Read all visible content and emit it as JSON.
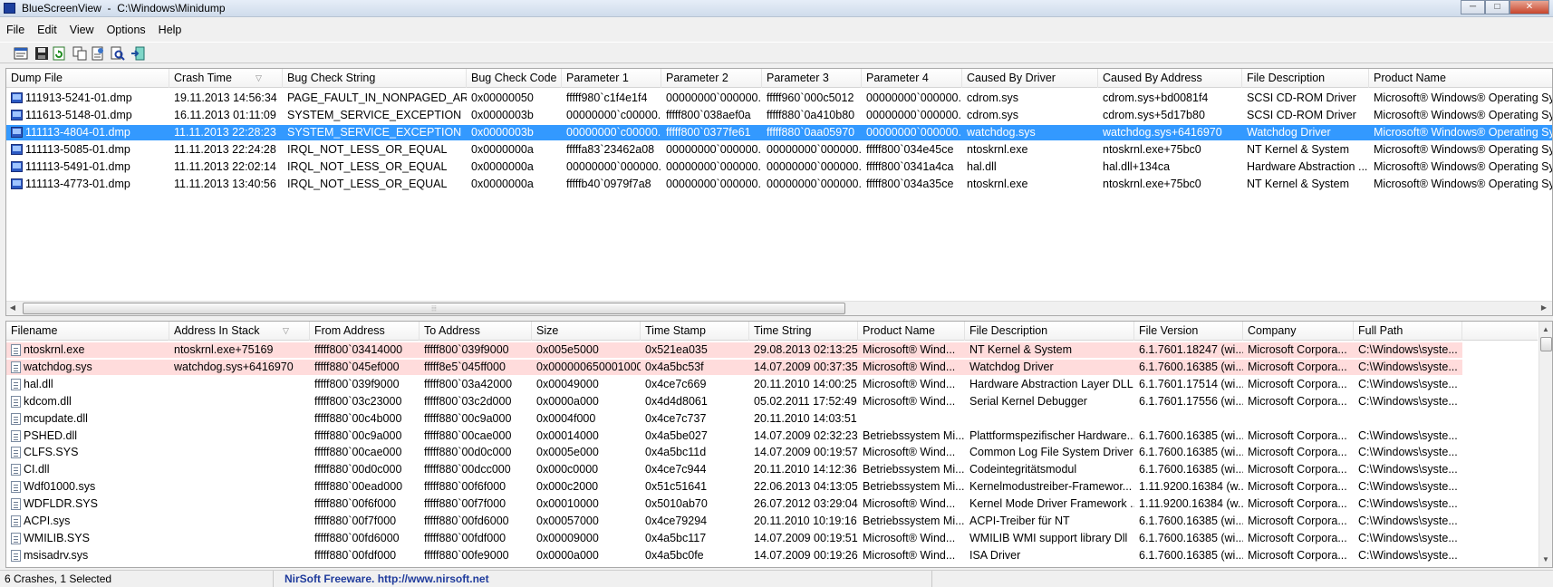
{
  "window": {
    "title": "BlueScreenView",
    "path": "C:\\Windows\\Minidump",
    "minimize": "─",
    "maximize": "□",
    "close": "✕"
  },
  "menu": [
    "File",
    "Edit",
    "View",
    "Options",
    "Help"
  ],
  "toolbar": [
    "properties-icon",
    "save-icon",
    "refresh-icon",
    "copy-icon",
    "html-report-icon",
    "find-icon",
    "exit-icon"
  ],
  "crashes": {
    "columns": [
      "Dump File",
      "Crash Time",
      "Bug Check String",
      "Bug Check Code",
      "Parameter 1",
      "Parameter 2",
      "Parameter 3",
      "Parameter 4",
      "Caused By Driver",
      "Caused By Address",
      "File Description",
      "Product Name"
    ],
    "sort_indicator": "▽",
    "rows": [
      [
        "111913-5241-01.dmp",
        "19.11.2013 14:56:34",
        "PAGE_FAULT_IN_NONPAGED_AREA",
        "0x00000050",
        "fffff980`c1f4e1f4",
        "00000000`000000...",
        "fffff960`000c5012",
        "00000000`000000...",
        "cdrom.sys",
        "cdrom.sys+bd0081f4",
        "SCSI CD-ROM Driver",
        "Microsoft® Windows® Operating Sy"
      ],
      [
        "111613-5148-01.dmp",
        "16.11.2013 01:11:09",
        "SYSTEM_SERVICE_EXCEPTION",
        "0x0000003b",
        "00000000`c00000...",
        "fffff800`038aef0a",
        "fffff880`0a410b80",
        "00000000`000000...",
        "cdrom.sys",
        "cdrom.sys+5d17b80",
        "SCSI CD-ROM Driver",
        "Microsoft® Windows® Operating Sy"
      ],
      [
        "111113-4804-01.dmp",
        "11.11.2013 22:28:23",
        "SYSTEM_SERVICE_EXCEPTION",
        "0x0000003b",
        "00000000`c00000...",
        "fffff800`0377fe61",
        "fffff880`0aa05970",
        "00000000`000000...",
        "watchdog.sys",
        "watchdog.sys+6416970",
        "Watchdog Driver",
        "Microsoft® Windows® Operating Sy"
      ],
      [
        "111113-5085-01.dmp",
        "11.11.2013 22:24:28",
        "IRQL_NOT_LESS_OR_EQUAL",
        "0x0000000a",
        "fffffa83`23462a08",
        "00000000`000000...",
        "00000000`000000...",
        "fffff800`034e45ce",
        "ntoskrnl.exe",
        "ntoskrnl.exe+75bc0",
        "NT Kernel & System",
        "Microsoft® Windows® Operating Sy"
      ],
      [
        "111113-5491-01.dmp",
        "11.11.2013 22:02:14",
        "IRQL_NOT_LESS_OR_EQUAL",
        "0x0000000a",
        "00000000`000000...",
        "00000000`000000...",
        "00000000`000000...",
        "fffff800`0341a4ca",
        "hal.dll",
        "hal.dll+134ca",
        "Hardware Abstraction ...",
        "Microsoft® Windows® Operating Sy"
      ],
      [
        "111113-4773-01.dmp",
        "11.11.2013 13:40:56",
        "IRQL_NOT_LESS_OR_EQUAL",
        "0x0000000a",
        "fffffb40`0979f7a8",
        "00000000`000000...",
        "00000000`000000...",
        "fffff800`034a35ce",
        "ntoskrnl.exe",
        "ntoskrnl.exe+75bc0",
        "NT Kernel & System",
        "Microsoft® Windows® Operating Sy"
      ]
    ],
    "selected_row": 2,
    "selection_color": "#3399ff",
    "splitter_grip": "⦙⦙⦙"
  },
  "drivers": {
    "columns": [
      "Filename",
      "Address In Stack",
      "From Address",
      "To Address",
      "Size",
      "Time Stamp",
      "Time String",
      "Product Name",
      "File Description",
      "File Version",
      "Company",
      "Full Path"
    ],
    "sort_indicator": "▽",
    "rows": [
      [
        "ntoskrnl.exe",
        "ntoskrnl.exe+75169",
        "fffff800`03414000",
        "fffff800`039f9000",
        "0x005e5000",
        "0x521ea035",
        "29.08.2013 02:13:25",
        "Microsoft® Wind...",
        "NT Kernel & System",
        "6.1.7601.18247 (wi...",
        "Microsoft Corpora...",
        "C:\\Windows\\syste..."
      ],
      [
        "watchdog.sys",
        "watchdog.sys+6416970",
        "fffff880`045ef000",
        "fffff8e5`045ff000",
        "0x000000650001000",
        "0x4a5bc53f",
        "14.07.2009 00:37:35",
        "Microsoft® Wind...",
        "Watchdog Driver",
        "6.1.7600.16385 (wi...",
        "Microsoft Corpora...",
        "C:\\Windows\\syste..."
      ],
      [
        "hal.dll",
        "",
        "fffff800`039f9000",
        "fffff800`03a42000",
        "0x00049000",
        "0x4ce7c669",
        "20.11.2010 14:00:25",
        "Microsoft® Wind...",
        "Hardware Abstraction Layer DLL",
        "6.1.7601.17514 (wi...",
        "Microsoft Corpora...",
        "C:\\Windows\\syste..."
      ],
      [
        "kdcom.dll",
        "",
        "fffff800`03c23000",
        "fffff800`03c2d000",
        "0x0000a000",
        "0x4d4d8061",
        "05.02.2011 17:52:49",
        "Microsoft® Wind...",
        "Serial Kernel Debugger",
        "6.1.7601.17556 (wi...",
        "Microsoft Corpora...",
        "C:\\Windows\\syste..."
      ],
      [
        "mcupdate.dll",
        "",
        "fffff880`00c4b000",
        "fffff880`00c9a000",
        "0x0004f000",
        "0x4ce7c737",
        "20.11.2010 14:03:51",
        "",
        "",
        "",
        "",
        ""
      ],
      [
        "PSHED.dll",
        "",
        "fffff880`00c9a000",
        "fffff880`00cae000",
        "0x00014000",
        "0x4a5be027",
        "14.07.2009 02:32:23",
        "Betriebssystem Mi...",
        "Plattformspezifischer Hardware...",
        "6.1.7600.16385 (wi...",
        "Microsoft Corpora...",
        "C:\\Windows\\syste..."
      ],
      [
        "CLFS.SYS",
        "",
        "fffff880`00cae000",
        "fffff880`00d0c000",
        "0x0005e000",
        "0x4a5bc11d",
        "14.07.2009 00:19:57",
        "Microsoft® Wind...",
        "Common Log File System Driver",
        "6.1.7600.16385 (wi...",
        "Microsoft Corpora...",
        "C:\\Windows\\syste..."
      ],
      [
        "CI.dll",
        "",
        "fffff880`00d0c000",
        "fffff880`00dcc000",
        "0x000c0000",
        "0x4ce7c944",
        "20.11.2010 14:12:36",
        "Betriebssystem Mi...",
        "Codeintegritätsmodul",
        "6.1.7600.16385 (wi...",
        "Microsoft Corpora...",
        "C:\\Windows\\syste..."
      ],
      [
        "Wdf01000.sys",
        "",
        "fffff880`00ead000",
        "fffff880`00f6f000",
        "0x000c2000",
        "0x51c51641",
        "22.06.2013 04:13:05",
        "Betriebssystem Mi...",
        "Kernelmodustreiber-Framewor...",
        "1.11.9200.16384 (w...",
        "Microsoft Corpora...",
        "C:\\Windows\\syste..."
      ],
      [
        "WDFLDR.SYS",
        "",
        "fffff880`00f6f000",
        "fffff880`00f7f000",
        "0x00010000",
        "0x5010ab70",
        "26.07.2012 03:29:04",
        "Microsoft® Wind...",
        "Kernel Mode Driver Framework ...",
        "1.11.9200.16384 (w...",
        "Microsoft Corpora...",
        "C:\\Windows\\syste..."
      ],
      [
        "ACPI.sys",
        "",
        "fffff880`00f7f000",
        "fffff880`00fd6000",
        "0x00057000",
        "0x4ce79294",
        "20.11.2010 10:19:16",
        "Betriebssystem Mi...",
        "ACPI-Treiber für NT",
        "6.1.7600.16385 (wi...",
        "Microsoft Corpora...",
        "C:\\Windows\\syste..."
      ],
      [
        "WMILIB.SYS",
        "",
        "fffff880`00fd6000",
        "fffff880`00fdf000",
        "0x00009000",
        "0x4a5bc117",
        "14.07.2009 00:19:51",
        "Microsoft® Wind...",
        "WMILIB WMI support library Dll",
        "6.1.7600.16385 (wi...",
        "Microsoft Corpora...",
        "C:\\Windows\\syste..."
      ],
      [
        "msisadrv.sys",
        "",
        "fffff880`00fdf000",
        "fffff880`00fe9000",
        "0x0000a000",
        "0x4a5bc0fe",
        "14.07.2009 00:19:26",
        "Microsoft® Wind...",
        "ISA Driver",
        "6.1.7600.16385 (wi...",
        "Microsoft Corpora...",
        "C:\\Windows\\syste..."
      ]
    ],
    "highlighted_rows": [
      0,
      1
    ],
    "highlight_color": "#ffdcdc"
  },
  "status": {
    "count": "6 Crashes, 1 Selected",
    "freeware": "NirSoft Freeware.  http://www.nirsoft.net"
  }
}
